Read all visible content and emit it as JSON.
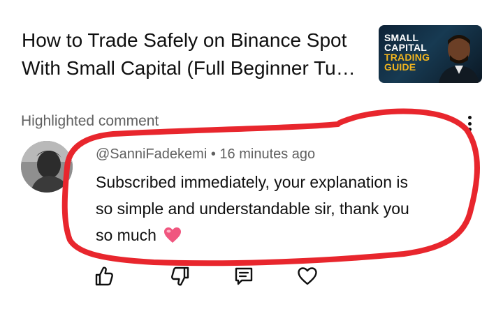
{
  "video": {
    "title_line1": "How to Trade Safely on Binance Spot",
    "title_line2": "With Small Capital (Full Beginner Tu…",
    "thumbnail": {
      "line1": "SMALL",
      "line2": "CAPITAL",
      "line3": "TRADING",
      "line4": "GUIDE"
    }
  },
  "section": {
    "label": "Highlighted comment",
    "more_icon": "more-vertical-icon"
  },
  "comment": {
    "author": "@SanniFadekemi",
    "separator": "•",
    "time": "16 minutes ago",
    "text_line1": "Subscribed immediately, your explanation is",
    "text_line2": "so simple and understandable sir, thank you",
    "text_line3": "so much",
    "emoji": "heart-emoji"
  },
  "actions": {
    "like_icon": "thumbs-up-icon",
    "dislike_icon": "thumbs-down-icon",
    "reply_icon": "reply-comment-icon",
    "heart_icon": "heart-outline-icon"
  },
  "colors": {
    "primary_text": "#0f0f0f",
    "secondary_text": "#606060",
    "annotation_red": "#e8262d",
    "thumb_gold": "#f2b51e"
  }
}
